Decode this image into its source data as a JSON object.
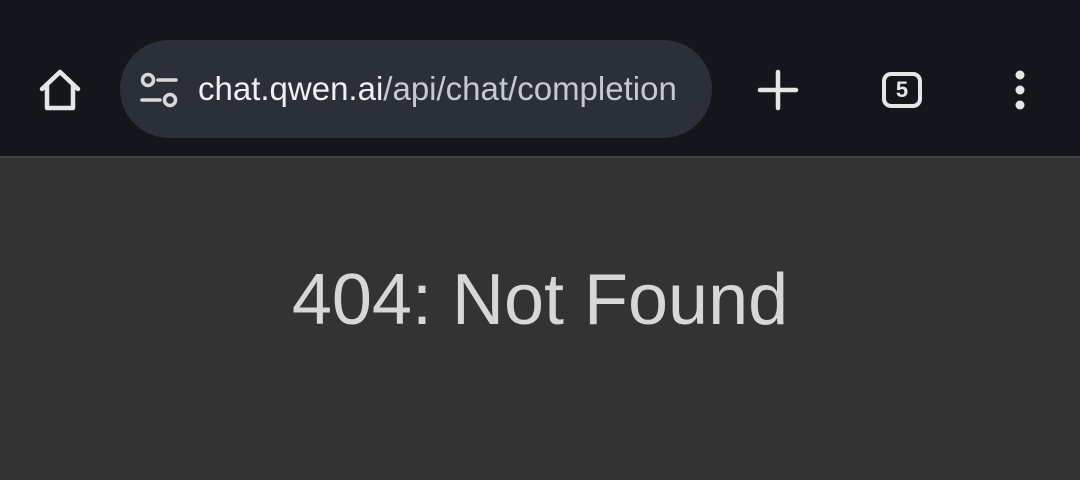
{
  "toolbar": {
    "home_icon": "home-icon",
    "site_settings_icon": "tune-icon",
    "url_host": "chat.qwen.ai",
    "url_path": "/api/chat/completion",
    "new_tab_icon": "plus-icon",
    "tab_count": "5",
    "menu_icon": "kebab-menu-icon"
  },
  "page": {
    "error_message": "404: Not Found"
  },
  "colors": {
    "toolbar_bg": "#14161b",
    "omnibox_bg": "#2b2f3a",
    "page_bg": "#333333",
    "text": "#d7d7d7"
  }
}
